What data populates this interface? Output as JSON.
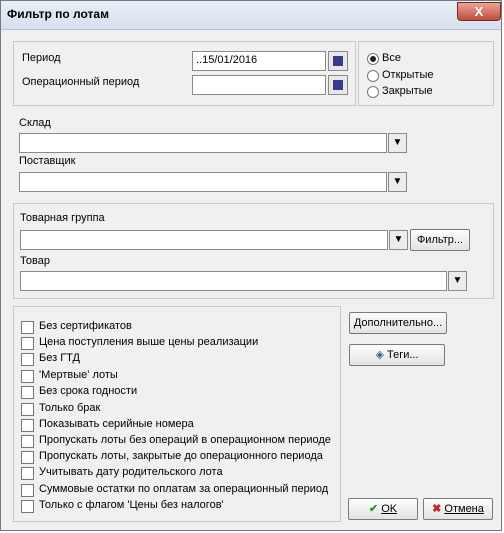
{
  "window": {
    "title": "Фильтр по лотам",
    "close_symbol": "X"
  },
  "period": {
    "period_label": "Период",
    "period_value": "..15/01/2016",
    "op_period_label": "Операционный период",
    "op_period_value": ""
  },
  "status": {
    "options": [
      "Все",
      "Открытые",
      "Закрытые"
    ],
    "selected": 0
  },
  "warehouse": {
    "label": "Склад",
    "value": ""
  },
  "supplier": {
    "label": "Поставщик",
    "value": ""
  },
  "product_group": {
    "label": "Товарная группа",
    "value": "",
    "filter_button": "Фильтр..."
  },
  "product": {
    "label": "Товар",
    "value": ""
  },
  "options": [
    "Без сертификатов",
    "Цена поступления выше цены реализации",
    "Без ГТД",
    "'Мертвые' лоты",
    "Без срока годности",
    "Только брак",
    "Показывать серийные номера",
    "Пропускать лоты без операций в операционном периоде",
    "Пропускать лоты, закрытые до операционного периода",
    "Учитывать дату родительского лота",
    "Суммовые остатки по оплатам за операционный период",
    "Только с флагом 'Цены без налогов'"
  ],
  "buttons": {
    "additional": "Дополнительно...",
    "tags": "Теги...",
    "ok": "OK",
    "cancel": "Отмена"
  }
}
